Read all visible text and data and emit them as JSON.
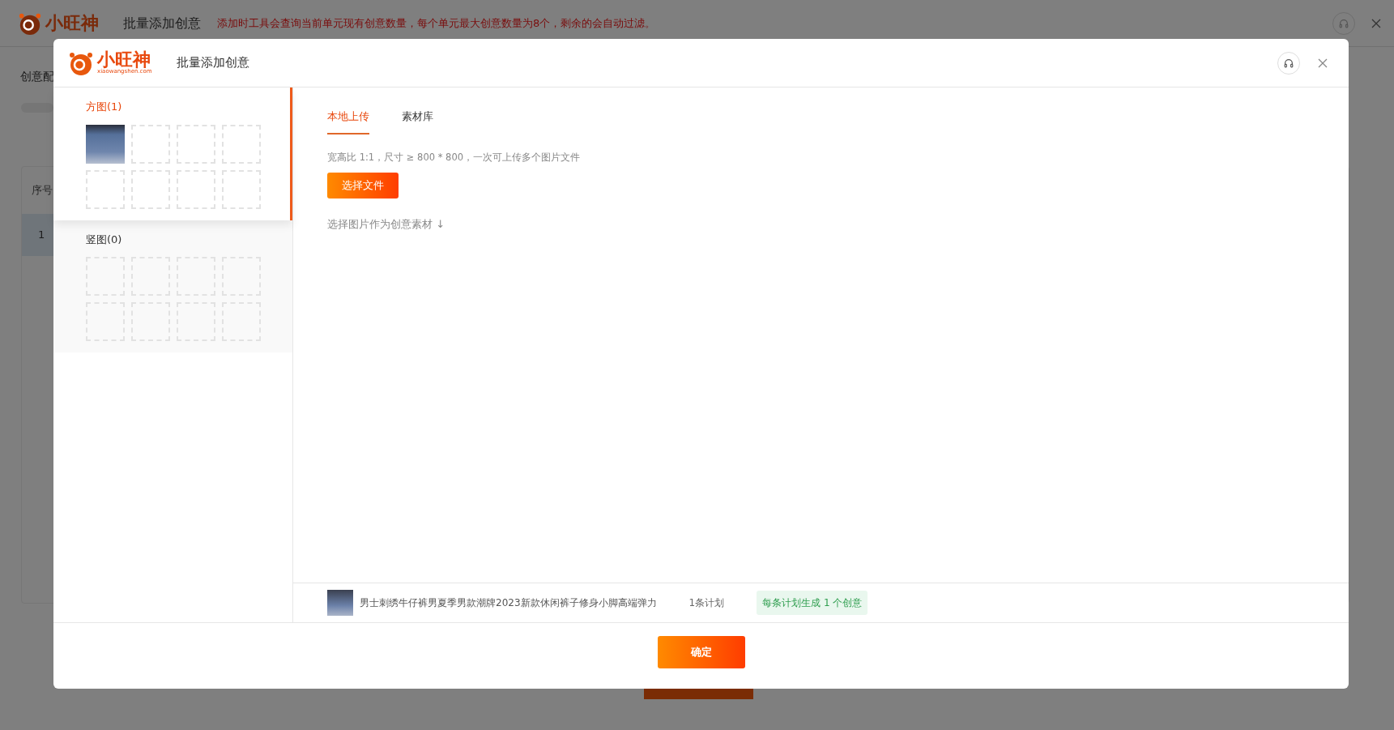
{
  "background_page": {
    "logo": {
      "name": "小旺神"
    },
    "title": "批量添加创意",
    "notice": "添加时工具会查询当前单元现有创意数量，每个单元最大创意数量为8个，剩余的会自动过滤。",
    "section_label": "创意配",
    "table": {
      "columns": [
        "序号"
      ],
      "rows": [
        [
          "1"
        ]
      ]
    }
  },
  "dialog": {
    "logo": {
      "name": "小旺神",
      "domain": "xiaowangshen.com"
    },
    "title": "批量添加创意",
    "image_groups": [
      {
        "label": "方图(1)",
        "selected": true,
        "slots": [
          {
            "filled": true
          },
          {
            "filled": false
          },
          {
            "filled": false
          },
          {
            "filled": false
          },
          {
            "filled": false
          },
          {
            "filled": false
          },
          {
            "filled": false
          },
          {
            "filled": false
          }
        ]
      },
      {
        "label": "竖图(0)",
        "selected": false,
        "slots": [
          {
            "filled": false
          },
          {
            "filled": false
          },
          {
            "filled": false
          },
          {
            "filled": false
          },
          {
            "filled": false
          },
          {
            "filled": false
          },
          {
            "filled": false
          },
          {
            "filled": false
          }
        ]
      }
    ],
    "tabs": [
      {
        "label": "本地上传",
        "selected": true
      },
      {
        "label": "素材库",
        "selected": false
      }
    ],
    "hint": "宽高比 1:1，尺寸 ≥ 800 * 800，一次可上传多个图片文件",
    "choose_button": "选择文件",
    "select_note": "选择图片作为创意素材 ↓",
    "products": [
      {
        "title": "男士刺绣牛仔裤男夏季男款潮牌2023新款休闲裤子修身小脚高端弹力",
        "plans": "1条计划",
        "tag": "每条计划生成 1 个创意"
      }
    ],
    "confirm_button": "确定"
  }
}
